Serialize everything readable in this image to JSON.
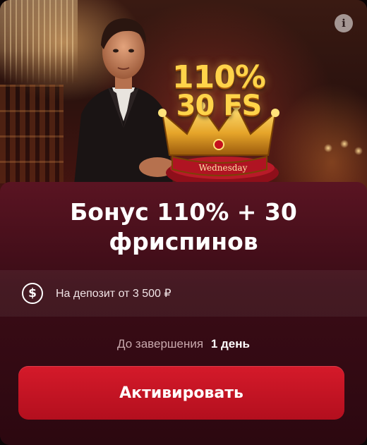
{
  "promo": {
    "bonus_percent": "110%",
    "free_spins": "30 FS",
    "ribbon": "Wednesday"
  },
  "info_icon": {
    "label": "i",
    "icon": "info-icon"
  },
  "offer": {
    "title": "Бонус 110% + 30 фриспинов",
    "deposit_icon": "dollar-coin-icon",
    "deposit_symbol": "$",
    "deposit_text": "На депозит от 3 500 ₽",
    "timer_label": "До завершения",
    "timer_value": "1 день",
    "activate_label": "Активировать"
  },
  "colors": {
    "accent": "#c8141f",
    "gold": "#ffd44a",
    "panel": "#3a0c16"
  }
}
